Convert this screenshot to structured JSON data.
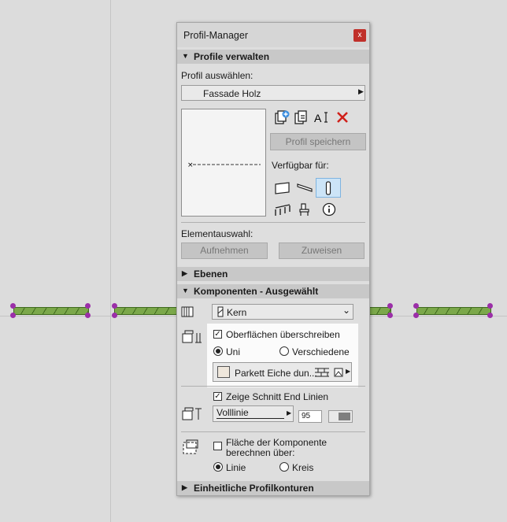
{
  "window": {
    "title": "Profil-Manager",
    "close_glyph": "x"
  },
  "profile_section": {
    "header": "Profile verwalten",
    "select_label": "Profil auswählen:",
    "selected_profile": "Fassade Holz",
    "save_button": "Profil speichern",
    "available_label": "Verfügbar für:",
    "element_label": "Elementauswahl:",
    "pick_button": "Aufnehmen",
    "assign_button": "Zuweisen"
  },
  "ebenen_section": {
    "header": "Ebenen"
  },
  "components_section": {
    "header": "Komponenten - Ausgewählt",
    "component_value": "Kern",
    "override_surfaces_label": "Oberflächen überschreiben",
    "override_surfaces_checked": true,
    "radio_uni": "Uni",
    "radio_various": "Verschiedene",
    "uni_selected": true,
    "surface_value": "Parkett Eiche dun...",
    "show_end_lines_label": "Zeige Schnitt End Linien",
    "show_end_lines_checked": true,
    "line_type": "Volllinie",
    "pen_number": "95",
    "area_calc_label_1": "Fläche der Komponente",
    "area_calc_label_2": "berechnen über:",
    "area_calc_checked": false,
    "radio_line": "Linie",
    "radio_circle": "Kreis",
    "line_selected": true
  },
  "uniform_section": {
    "header": "Einheitliche Profilkonturen"
  },
  "colors": {
    "panel_bg": "#dedede",
    "section_bg": "#c8c8c8",
    "wall_fill": "#7ba84a",
    "node": "#9b2fa8",
    "close_btn": "#c0302a",
    "delete_icon": "#d0201a",
    "selected_icon_bg": "#cce4f7"
  }
}
